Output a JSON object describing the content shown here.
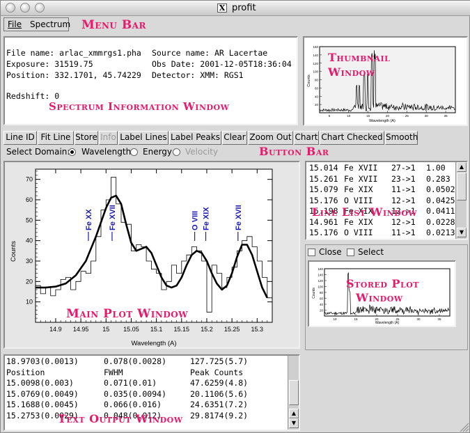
{
  "window": {
    "title": "profit"
  },
  "menu": {
    "file": "File",
    "spectrum": "Spectrum"
  },
  "annotations": {
    "menu_bar": "Menu Bar",
    "thumbnail_line1": "Thumbnail",
    "thumbnail_line2": "Window",
    "spectrum_info": "Spectrum Information Window",
    "button_bar": "Button Bar",
    "line_list": "Line List Window",
    "main_plot": "Main Plot Window",
    "stored_plot_line1": "Stored Plot",
    "stored_plot_line2": "Window",
    "text_output": "Text Output Window"
  },
  "info": {
    "file_name": "File name: arlac_xmmrgs1.pha",
    "source_name": "Source name: AR Lacertae",
    "exposure": "Exposure: 31519.75",
    "obs_date": "Obs Date: 2001-12-05T18:36:04",
    "position": "Position: 332.1701, 45.74229",
    "detector": "Detector: XMM: RGS1",
    "redshift": "Redshift: 0"
  },
  "buttons": [
    "Line ID",
    "Fit Line",
    "Store",
    "Info",
    "Label Lines",
    "Label Peaks",
    "Clear",
    "Zoom Out",
    "Chart",
    "Chart Checked",
    "Smooth"
  ],
  "domain": {
    "label": "Select Domain:",
    "options": [
      "Wavelength",
      "Energy",
      "Velocity"
    ],
    "selected": "Wavelength"
  },
  "line_list": [
    {
      "wave": "15.014",
      "ion": "Fe XVII",
      "trans": "27->1",
      "val": "1.00"
    },
    {
      "wave": "15.261",
      "ion": "Fe XVII",
      "trans": "23->1",
      "val": "0.283"
    },
    {
      "wave": "15.079",
      "ion": "Fe XIX",
      "trans": "11->1",
      "val": "0.0502"
    },
    {
      "wave": "15.176",
      "ion": "O VIII",
      "trans": "12->1",
      "val": "0.0425"
    },
    {
      "wave": "15.198",
      "ion": "Fe XIX",
      "trans": "12->1",
      "val": "0.0411"
    },
    {
      "wave": "14.961",
      "ion": "Fe XIX",
      "trans": "12->1",
      "val": "0.0228"
    },
    {
      "wave": "15.176",
      "ion": "O VIII",
      "trans": "11->1",
      "val": "0.0213"
    }
  ],
  "stored": {
    "close_label": "Close",
    "select_label": "Select"
  },
  "text_output": [
    {
      "c1": "18.9703(0.0013)",
      "c2": "0.078(0.0028)",
      "c3": "127.725(5.7)"
    },
    {
      "c1": "Position",
      "c2": "FWHM",
      "c3": "Peak Counts"
    },
    {
      "c1": "15.0098(0.003)",
      "c2": "0.071(0.01)",
      "c3": "47.6259(4.8)"
    },
    {
      "c1": "15.0769(0.0049)",
      "c2": "0.035(0.0094)",
      "c3": "20.1106(5.6)"
    },
    {
      "c1": "15.1688(0.0045)",
      "c2": "0.066(0.016)",
      "c3": "24.6351(7.2)"
    },
    {
      "c1": "15.2753(0.0029)",
      "c2": "0.048(0.012)",
      "c3": "29.8174(9.2)"
    }
  ],
  "main_plot": {
    "xlabel": "Wavelength (A)",
    "ylabel": "Counts",
    "xlim": [
      14.86,
      15.33
    ],
    "ylim": [
      0,
      75
    ],
    "xticks": [
      14.9,
      14.95,
      15,
      15.05,
      15.1,
      15.15,
      15.2,
      15.25,
      15.3
    ],
    "xticklabels": [
      "14.9",
      "14.95",
      "15",
      "15.05",
      "15.1",
      "15.15",
      "15.2",
      "15.25",
      "15.3"
    ],
    "yticks": [
      10,
      20,
      30,
      40,
      50,
      60,
      70
    ],
    "yticklabels": [
      "10",
      "20",
      "30",
      "40",
      "50",
      "60",
      "70"
    ],
    "line_labels": [
      {
        "x": 14.965,
        "text": "Fe XX"
      },
      {
        "x": 15.012,
        "text": "Fe XVII"
      },
      {
        "x": 15.176,
        "text": "O VIII"
      },
      {
        "x": 15.198,
        "text": "Fe XIX"
      },
      {
        "x": 15.262,
        "text": "Fe XVII"
      }
    ],
    "hist_x": [
      14.86,
      14.87,
      14.88,
      14.89,
      14.9,
      14.91,
      14.92,
      14.93,
      14.94,
      14.95,
      14.96,
      14.97,
      14.98,
      14.99,
      15.0,
      15.01,
      15.02,
      15.03,
      15.04,
      15.05,
      15.06,
      15.07,
      15.08,
      15.09,
      15.1,
      15.11,
      15.12,
      15.13,
      15.14,
      15.15,
      15.16,
      15.17,
      15.18,
      15.19,
      15.2,
      15.21,
      15.22,
      15.23,
      15.24,
      15.25,
      15.26,
      15.27,
      15.28,
      15.29,
      15.3,
      15.31,
      15.32
    ],
    "hist_y": [
      18,
      14,
      17,
      13,
      16,
      21,
      22,
      16,
      20,
      25,
      24,
      30,
      42,
      55,
      60,
      71,
      58,
      49,
      48,
      35,
      38,
      37,
      30,
      26,
      24,
      16,
      20,
      28,
      24,
      30,
      33,
      37,
      35,
      30,
      5,
      28,
      24,
      17,
      22,
      27,
      35,
      40,
      42,
      37,
      30,
      22,
      12
    ],
    "fit_x": [
      14.86,
      14.88,
      14.9,
      14.92,
      14.94,
      14.96,
      14.98,
      15.0,
      15.01,
      15.02,
      15.03,
      15.04,
      15.05,
      15.06,
      15.07,
      15.08,
      15.09,
      15.1,
      15.11,
      15.12,
      15.13,
      15.14,
      15.15,
      15.16,
      15.17,
      15.18,
      15.19,
      15.2,
      15.21,
      15.22,
      15.23,
      15.24,
      15.25,
      15.26,
      15.27,
      15.28,
      15.29,
      15.3,
      15.31,
      15.32
    ],
    "fit_y": [
      17,
      17,
      17.5,
      19,
      23,
      30,
      42,
      56,
      61,
      62,
      58,
      48,
      39,
      35,
      36,
      37,
      34,
      28,
      22,
      18,
      17,
      18,
      22,
      28,
      33,
      35,
      34,
      30,
      24,
      19,
      16,
      18,
      24,
      32,
      38,
      38,
      33,
      25,
      17,
      12
    ]
  },
  "thumbnail": {
    "xlabel": "Wavelength (A)",
    "ylabel": "Counts",
    "yticklabels": [
      "20",
      "40",
      "60",
      "80",
      "100",
      "120",
      "140",
      "160"
    ],
    "xticklabels": [
      "5",
      "10",
      "15",
      "20",
      "25",
      "30",
      "35"
    ]
  },
  "stored_plot": {
    "xlabel": "Wavelength (A)",
    "ylabel": "Counts",
    "yticklabels": [
      "20",
      "40",
      "60",
      "80",
      "100",
      "120",
      "140",
      "160"
    ],
    "xticklabels": [
      "10",
      "15",
      "20",
      "25",
      "30",
      "35"
    ]
  }
}
